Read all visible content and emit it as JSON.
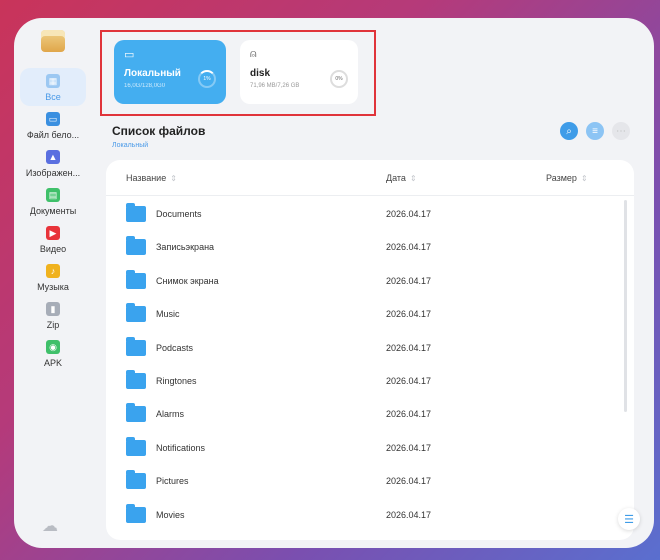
{
  "sidebar": {
    "items": [
      {
        "label": "Все",
        "icon": "grid-icon",
        "color": "#4a9ae8"
      },
      {
        "label": "Файл бело...",
        "icon": "whiteboard-icon",
        "color": "#3a8fe0"
      },
      {
        "label": "Изображен...",
        "icon": "image-icon",
        "color": "#5a6fe0"
      },
      {
        "label": "Документы",
        "icon": "document-icon",
        "color": "#3fc06a"
      },
      {
        "label": "Видео",
        "icon": "video-icon",
        "color": "#e8333a"
      },
      {
        "label": "Музыка",
        "icon": "music-icon",
        "color": "#f0b21e"
      },
      {
        "label": "Zip",
        "icon": "zip-icon",
        "color": "#a7adb8"
      },
      {
        "label": "APK",
        "icon": "android-icon",
        "color": "#3fc06a"
      }
    ]
  },
  "storage": {
    "local": {
      "name": "Локальный",
      "size": "16,0G/128,0G0",
      "usage": "1%"
    },
    "disk": {
      "name": "disk",
      "size": "71,96 MB/7,26 GB",
      "usage": "0%"
    }
  },
  "list": {
    "title": "Список файлов",
    "path": "Локальный",
    "columns": {
      "name": "Название",
      "date": "Дата",
      "size": "Размер"
    }
  },
  "files": [
    {
      "name": "Documents",
      "date": "2026.04.17"
    },
    {
      "name": "Записьэкрана",
      "date": "2026.04.17"
    },
    {
      "name": "Снимок экрана",
      "date": "2026.04.17"
    },
    {
      "name": "Music",
      "date": "2026.04.17"
    },
    {
      "name": "Podcasts",
      "date": "2026.04.17"
    },
    {
      "name": "Ringtones",
      "date": "2026.04.17"
    },
    {
      "name": "Alarms",
      "date": "2026.04.17"
    },
    {
      "name": "Notifications",
      "date": "2026.04.17"
    },
    {
      "name": "Pictures",
      "date": "2026.04.17"
    },
    {
      "name": "Movies",
      "date": "2026.04.17"
    }
  ],
  "colors": {
    "accent": "#3f9ce8",
    "highlight": "#e0343a"
  }
}
